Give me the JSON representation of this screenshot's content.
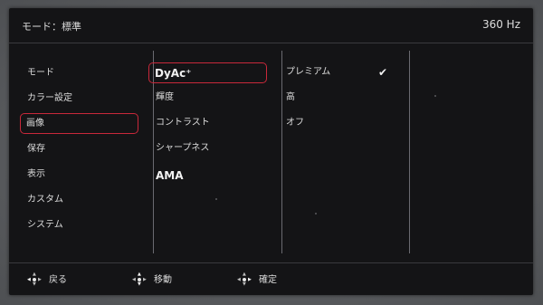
{
  "header": {
    "title": "モード：標準",
    "refresh_rate": "360 Hz"
  },
  "menu": {
    "col1": [
      "モード",
      "カラー設定",
      "画像",
      "保存",
      "表示",
      "カスタム",
      "システム"
    ],
    "col2": [
      "DyAc⁺",
      "輝度",
      "コントラスト",
      "シャープネス",
      "AMA"
    ],
    "col3": [
      "プレミアム",
      "高",
      "オフ"
    ],
    "check": "✔"
  },
  "footer": {
    "back": "戻る",
    "move": "移動",
    "confirm": "確定"
  },
  "colors": {
    "selection": "#c8283a",
    "panel": "#141416"
  },
  "icons": {
    "joystick": "joystick-icon",
    "check": "check-icon"
  }
}
